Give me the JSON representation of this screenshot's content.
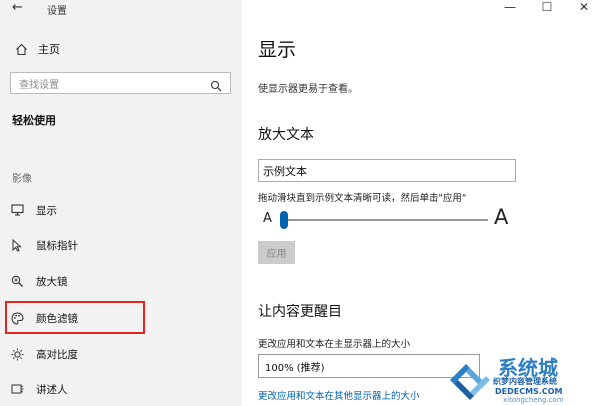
{
  "window": {
    "title": "设置",
    "minimize": "—",
    "maximize": "☐",
    "close": "✕",
    "back": "←"
  },
  "sidebar": {
    "home_label": "主页",
    "search_placeholder": "查找设置",
    "section_heading": "轻松使用",
    "category_label": "影像",
    "items": [
      {
        "label": "显示",
        "icon": "monitor-icon"
      },
      {
        "label": "鼠标指针",
        "icon": "mouse-pointer-icon"
      },
      {
        "label": "放大镜",
        "icon": "magnifier-icon"
      },
      {
        "label": "颜色滤镜",
        "icon": "palette-icon"
      },
      {
        "label": "高对比度",
        "icon": "contrast-icon"
      },
      {
        "label": "讲述人",
        "icon": "narrator-icon"
      }
    ]
  },
  "main": {
    "title": "显示",
    "subtitle": "使显示器更易于查看。",
    "enlarge_text": {
      "heading": "放大文本",
      "sample_text": "示例文本",
      "instruction": "拖动滑块直到示例文本清晰可读，然后单击\"应用\"",
      "slider_min_label": "A",
      "slider_max_label": "A",
      "slider_value": 0,
      "apply_label": "应用"
    },
    "make_bigger": {
      "heading": "让内容更醒目",
      "size_label": "更改应用和文本在主显示器上的大小",
      "size_value": "100% (推荐)",
      "other_display_link": "更改应用和文本在其他显示器上的大小"
    }
  },
  "watermark": {
    "title": "系统城",
    "subtitle": "织梦内容管理系统",
    "url": "DEDECMS.COM",
    "url2": "xitongcheng.com"
  },
  "colors": {
    "accent": "#0063b1",
    "highlight": "#e0271c",
    "sidebar_bg": "#f2f2f2"
  }
}
